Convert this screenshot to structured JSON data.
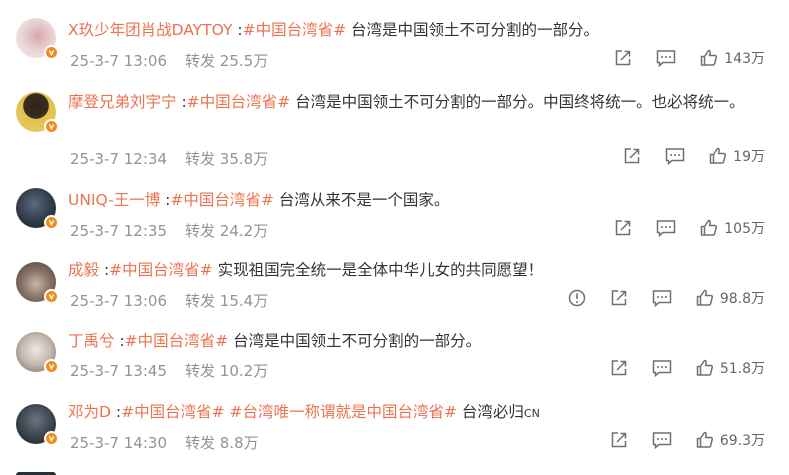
{
  "comments": [
    {
      "user": "X玖少年团肖战DAYTOY",
      "colon": " :",
      "tag": "#中国台湾省#",
      "text": " 台湾是中国领土不可分割的一部分。",
      "time": "25-3-7 13:06",
      "repost_label": "转发",
      "repost_count": "25.5万",
      "likes": "143万",
      "avatar_colors": [
        "#e9d7d8",
        "#c8a2a6"
      ],
      "has_report": false
    },
    {
      "user": "摩登兄弟刘宇宁",
      "colon": " :",
      "tag": "#中国台湾省#",
      "text": " 台湾是中国领土不可分割的一部分。中国终将统一。也必将统一。",
      "time": "25-3-7 12:34",
      "repost_label": "转发",
      "repost_count": "35.8万",
      "likes": "19万",
      "avatar_colors": [
        "#e8c65a",
        "#3a2a20"
      ],
      "has_report": false
    },
    {
      "user": "UNIQ-王一博",
      "colon": " :",
      "tag": "#中国台湾省#",
      "text": " 台湾从来不是一个国家。",
      "time": "25-3-7 12:35",
      "repost_label": "转发",
      "repost_count": "24.2万",
      "likes": "105万",
      "avatar_colors": [
        "#3d4a5c",
        "#1c2330"
      ],
      "has_report": false
    },
    {
      "user": "成毅",
      "colon": " :",
      "tag": "#中国台湾省#",
      "text": " 实现祖国完全统一是全体中华儿女的共同愿望！",
      "time": "25-3-7 13:06",
      "repost_label": "转发",
      "repost_count": "15.4万",
      "likes": "98.8万",
      "avatar_colors": [
        "#b9aba2",
        "#5a4b44"
      ],
      "has_report": true
    },
    {
      "user": "丁禹兮",
      "colon": " :",
      "tag": "#中国台湾省#",
      "text": " 台湾是中国领土不可分割的一部分。",
      "time": "25-3-7 13:45",
      "repost_label": "转发",
      "repost_count": "10.2万",
      "likes": "51.8万",
      "avatar_colors": [
        "#d9d3cc",
        "#7b716a"
      ],
      "has_report": false
    },
    {
      "user": "邓为D",
      "colon": " :",
      "tag": "#中国台湾省#",
      "tag2": " #台湾唯一称谓就是中国台湾省#",
      "text": " 台湾必归",
      "text_small": "CN",
      "time": "25-3-7 14:30",
      "repost_label": "转发",
      "repost_count": "8.8万",
      "likes": "69.3万",
      "avatar_colors": [
        "#3a4148",
        "#1a1e22"
      ],
      "has_report": false
    }
  ],
  "colors": {
    "accent": "#eb7350",
    "meta": "#939393",
    "badge": "#f28b1b"
  },
  "icons": [
    "share-icon",
    "comment-icon",
    "like-icon",
    "report-icon",
    "verified-badge-icon"
  ]
}
